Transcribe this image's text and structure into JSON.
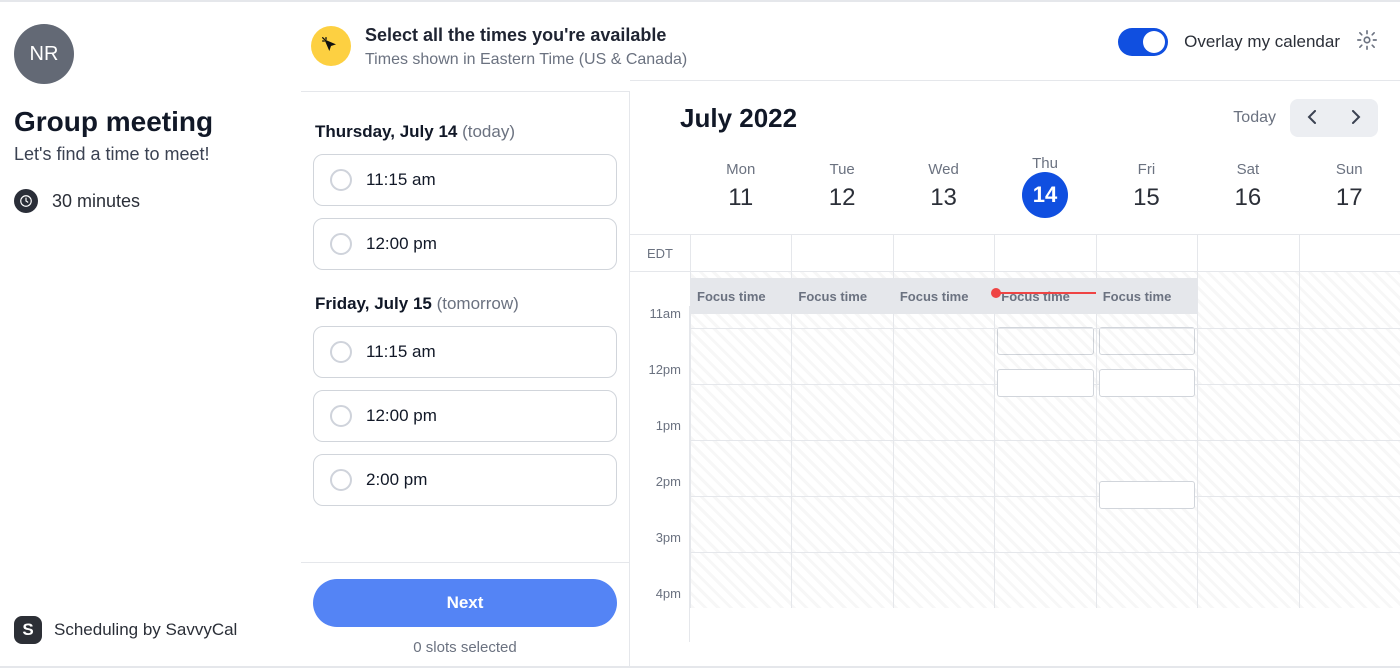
{
  "avatar_initials": "NR",
  "meeting": {
    "title": "Group meeting",
    "description": "Let's find a time to meet!",
    "duration": "30 minutes"
  },
  "banner": {
    "title": "Select all the times you're available",
    "subtitle": "Times shown in Eastern Time (US & Canada)"
  },
  "days": [
    {
      "label": "Thursday, July 14",
      "tag": "(today)",
      "slots": [
        "11:15 am",
        "12:00 pm"
      ]
    },
    {
      "label": "Friday, July 15",
      "tag": "(tomorrow)",
      "slots": [
        "11:15 am",
        "12:00 pm",
        "2:00 pm"
      ]
    }
  ],
  "next_label": "Next",
  "slots_selected": "0 slots selected",
  "overlay_label": "Overlay my calendar",
  "calendar": {
    "month_label": "July 2022",
    "today_label": "Today",
    "tz": "EDT",
    "week": [
      {
        "dow": "Mon",
        "dom": "11"
      },
      {
        "dow": "Tue",
        "dom": "12"
      },
      {
        "dow": "Wed",
        "dom": "13"
      },
      {
        "dow": "Thu",
        "dom": "14",
        "today": true
      },
      {
        "dow": "Fri",
        "dom": "15"
      },
      {
        "dow": "Sat",
        "dom": "16"
      },
      {
        "dow": "Sun",
        "dom": "17"
      }
    ],
    "times": [
      "11am",
      "12pm",
      "1pm",
      "2pm",
      "3pm",
      "4pm"
    ],
    "focus_label": "Focus time"
  },
  "footer": "Scheduling by SavvyCal"
}
